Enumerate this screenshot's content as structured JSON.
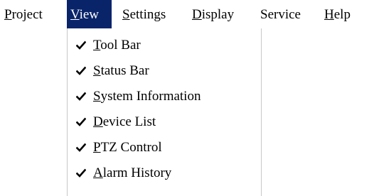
{
  "menubar": {
    "items": [
      {
        "mnemonic": "P",
        "rest": "roject"
      },
      {
        "mnemonic": "V",
        "rest": "iew",
        "active": true
      },
      {
        "mnemonic": "S",
        "rest": "ettings"
      },
      {
        "mnemonic": "D",
        "rest": "isplay"
      },
      {
        "mnemonic": "",
        "rest": "Service"
      },
      {
        "mnemonic": "H",
        "rest": "elp"
      }
    ]
  },
  "view_menu": {
    "items": [
      {
        "mnemonic": "T",
        "rest": "ool Bar",
        "checked": true,
        "icon": "check-icon"
      },
      {
        "mnemonic": "S",
        "rest": "tatus Bar",
        "checked": true,
        "icon": "check-icon"
      },
      {
        "mnemonic": "S",
        "rest": "ystem Information",
        "checked": true,
        "icon": "check-icon"
      },
      {
        "mnemonic": "D",
        "rest": "evice List",
        "checked": true,
        "icon": "check-icon"
      },
      {
        "mnemonic": "P",
        "rest": "TZ Control",
        "checked": true,
        "icon": "check-icon"
      },
      {
        "mnemonic": "A",
        "rest": "larm History",
        "checked": true,
        "icon": "check-icon"
      }
    ]
  },
  "colors": {
    "highlight": "#0a246a",
    "highlight_text": "#ffffff",
    "text": "#000000",
    "background": "#ffffff"
  }
}
